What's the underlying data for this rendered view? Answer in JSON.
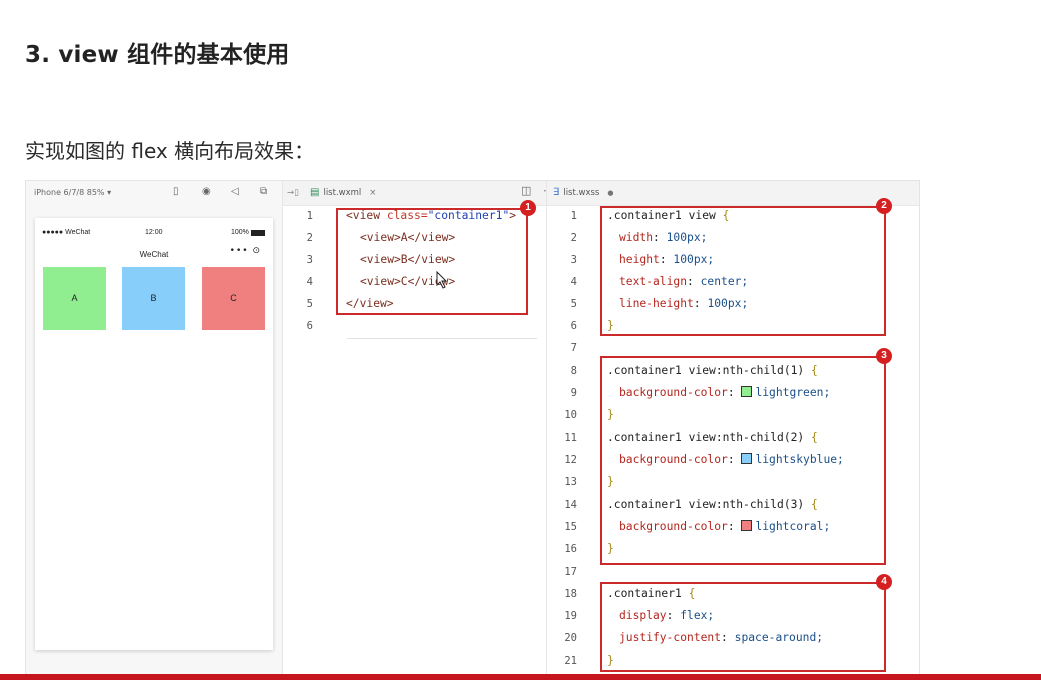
{
  "heading": "3. view 组件的基本使用",
  "description": "实现如图的 flex 横向布局效果：",
  "colors": {
    "accent_red": "#c4161c",
    "box_red": "#cc2a2a",
    "lightgreen": "#90ee90",
    "lightskyblue": "#87cefa",
    "lightcoral": "#f08080"
  },
  "simulator": {
    "device": "iPhone 6/7/8 85% ▾",
    "status_signal": "●●●●● WeChat",
    "status_time": "12:00",
    "status_battery": "100%",
    "nav_title": "WeChat",
    "capsule": "•••  ⊙",
    "boxes": [
      "A",
      "B",
      "C"
    ]
  },
  "wxml_editor": {
    "tab_label": "list.wxml",
    "tab_close": "×",
    "icons": {
      "split": "split-editor-icon",
      "more": "more-icon"
    },
    "line_numbers": [
      "1",
      "2",
      "3",
      "4",
      "5",
      "6"
    ],
    "line1_open": "<view ",
    "line1_attr": "class=",
    "line1_val": "\"container1\"",
    "line1_close": ">",
    "line2": "<view>A</view>",
    "line3": "<view>B</view>",
    "line4": "<view>C</view>",
    "line5": "</view>",
    "badge": "1"
  },
  "wxss_editor": {
    "tab_label": "list.wxss",
    "tab_modified": "●",
    "line_numbers": [
      "1",
      "2",
      "3",
      "4",
      "5",
      "6",
      "7",
      "8",
      "9",
      "10",
      "11",
      "12",
      "13",
      "14",
      "15",
      "16",
      "17",
      "18",
      "19",
      "20",
      "21"
    ],
    "block1": {
      "selector": ".container1 view ",
      "open": "{",
      "width_prop": "width",
      "width_val": "100px;",
      "height_prop": "height",
      "height_val": "100px;",
      "align_prop": "text-align",
      "align_val": "center;",
      "lh_prop": "line-height",
      "lh_val": "100px;",
      "close": "}"
    },
    "block2": {
      "sel1": ".container1 view:nth-child(1) ",
      "bg1_prop": "background-color",
      "bg1_val": "lightgreen;",
      "sel2": ".container1 view:nth-child(2) ",
      "bg2_prop": "background-color",
      "bg2_val": "lightskyblue;",
      "sel3": ".container1 view:nth-child(3) ",
      "bg3_prop": "background-color",
      "bg3_val": "lightcoral;",
      "open": "{",
      "close": "}"
    },
    "block3": {
      "selector": ".container1 ",
      "open": "{",
      "display_prop": "display",
      "display_val": "flex;",
      "jc_prop": "justify-content",
      "jc_val": "space-around;",
      "close": "}"
    },
    "badges": [
      "2",
      "3",
      "4"
    ]
  }
}
